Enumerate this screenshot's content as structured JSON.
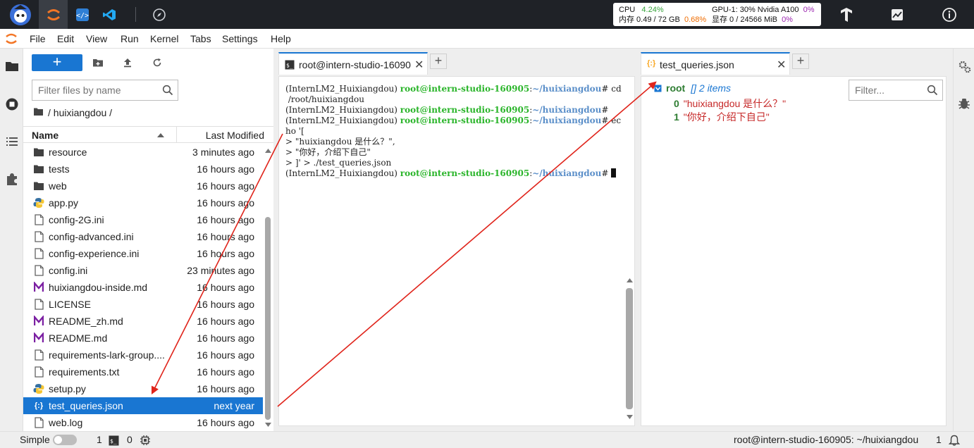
{
  "stats": {
    "cpu_label": "CPU",
    "cpu_value": "4.24%",
    "mem_label": "内存 0.49 / 72 GB",
    "mem_pct": "0.68%",
    "gpu_label": "GPU-1: 30% Nvidia A100",
    "gpu_pct": "0%",
    "vram_label": "显存 0 / 24566 MiB",
    "vram_pct": "0%"
  },
  "menu": [
    "File",
    "Edit",
    "View",
    "Run",
    "Kernel",
    "Tabs",
    "Settings",
    "Help"
  ],
  "filebrowser": {
    "new_label": "+",
    "filter_placeholder": "Filter files by name",
    "breadcrumb": "/ huixiangdou /",
    "col_name": "Name",
    "col_modified": "Last Modified",
    "files": [
      {
        "name": "resource",
        "modified": "3 minutes ago",
        "icon": "folder-icon"
      },
      {
        "name": "tests",
        "modified": "16 hours ago",
        "icon": "folder-icon"
      },
      {
        "name": "web",
        "modified": "16 hours ago",
        "icon": "folder-icon"
      },
      {
        "name": "app.py",
        "modified": "16 hours ago",
        "icon": "python-icon"
      },
      {
        "name": "config-2G.ini",
        "modified": "16 hours ago",
        "icon": "file-icon"
      },
      {
        "name": "config-advanced.ini",
        "modified": "16 hours ago",
        "icon": "file-icon"
      },
      {
        "name": "config-experience.ini",
        "modified": "16 hours ago",
        "icon": "file-icon"
      },
      {
        "name": "config.ini",
        "modified": "23 minutes ago",
        "icon": "file-icon"
      },
      {
        "name": "huixiangdou-inside.md",
        "modified": "16 hours ago",
        "icon": "markdown-icon"
      },
      {
        "name": "LICENSE",
        "modified": "16 hours ago",
        "icon": "file-icon"
      },
      {
        "name": "README_zh.md",
        "modified": "16 hours ago",
        "icon": "markdown-icon"
      },
      {
        "name": "README.md",
        "modified": "16 hours ago",
        "icon": "markdown-icon"
      },
      {
        "name": "requirements-lark-group....",
        "modified": "16 hours ago",
        "icon": "file-icon"
      },
      {
        "name": "requirements.txt",
        "modified": "16 hours ago",
        "icon": "file-icon"
      },
      {
        "name": "setup.py",
        "modified": "16 hours ago",
        "icon": "python-icon"
      },
      {
        "name": "test_queries.json",
        "modified": "next year",
        "icon": "json-icon",
        "selected": true
      },
      {
        "name": "web.log",
        "modified": "16 hours ago",
        "icon": "file-icon"
      }
    ]
  },
  "tabs": {
    "terminal_title": "root@intern-studio-16090",
    "json_title": "test_queries.json"
  },
  "terminal": {
    "lines": [
      {
        "env": "(InternLM2_Huixiangdou) ",
        "user": "root@intern-studio-160905",
        "sep": ":",
        "path": "~/huixiangdou",
        "cmd": "# cd"
      },
      {
        "text": " /root/huixiangdou"
      },
      {
        "env": "(InternLM2_Huixiangdou) ",
        "user": "root@intern-studio-160905",
        "sep": ":",
        "path": "~/huixiangdou",
        "cmd": "#"
      },
      {
        "env": "(InternLM2_Huixiangdou) ",
        "user": "root@intern-studio-160905",
        "sep": ":",
        "path": "~/huixiangdou",
        "cmd": "# ec"
      },
      {
        "text": "ho '["
      },
      {
        "text": "> \"huixiangdou 是什么？\","
      },
      {
        "text": "> \"你好，介绍下自己\""
      },
      {
        "text": "> ]' > ./test_queries.json"
      },
      {
        "env": "(InternLM2_Huixiangdou) ",
        "user": "root@intern-studio-160905",
        "sep": ":",
        "path": "~/huixiangdou",
        "cmd": "# ",
        "cursor": true
      }
    ]
  },
  "json": {
    "filter_placeholder": "Filter...",
    "root_key": "root",
    "root_meta": "[]  2 items",
    "items": [
      {
        "key": "0",
        "value": "\"huixiangdou 是什么？\""
      },
      {
        "key": "1",
        "value": "\"你好，介绍下自己\""
      }
    ]
  },
  "status": {
    "mode": "Simple",
    "kernels": "1",
    "terminals": "0",
    "right": "root@intern-studio-160905: ~/huixiangdou",
    "right_count": "1"
  },
  "colors": {
    "accent": "#1976d2",
    "annotation_arrow": "#e0241b"
  }
}
